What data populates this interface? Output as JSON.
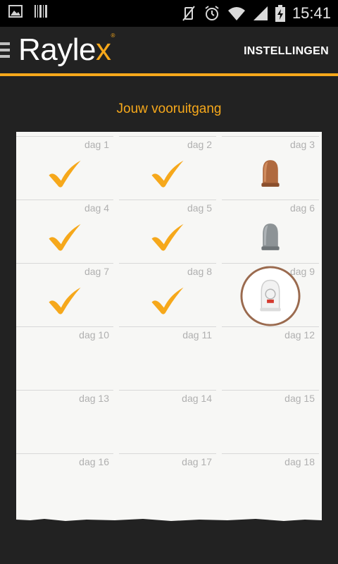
{
  "status": {
    "time": "15:41"
  },
  "header": {
    "logo_main": "Rayle",
    "logo_x": "x",
    "settings_label": "INSTELLINGEN"
  },
  "progress": {
    "title": "Jouw vooruitgang",
    "days": [
      {
        "label": "dag 1",
        "state": "check"
      },
      {
        "label": "dag 2",
        "state": "check"
      },
      {
        "label": "dag 3",
        "state": "thimble-wood"
      },
      {
        "label": "dag 4",
        "state": "check"
      },
      {
        "label": "dag 5",
        "state": "check"
      },
      {
        "label": "dag 6",
        "state": "thimble-silver"
      },
      {
        "label": "dag 7",
        "state": "check"
      },
      {
        "label": "dag 8",
        "state": "check"
      },
      {
        "label": "dag 9",
        "state": "thimble-white-current"
      },
      {
        "label": "dag 10",
        "state": "empty"
      },
      {
        "label": "dag 11",
        "state": "empty"
      },
      {
        "label": "dag 12",
        "state": "empty"
      },
      {
        "label": "dag 13",
        "state": "empty"
      },
      {
        "label": "dag 14",
        "state": "empty"
      },
      {
        "label": "dag 15",
        "state": "empty"
      },
      {
        "label": "dag 16",
        "state": "empty"
      },
      {
        "label": "dag 17",
        "state": "empty"
      },
      {
        "label": "dag 18",
        "state": "empty"
      }
    ]
  },
  "colors": {
    "accent": "#f6a81b",
    "background": "#222222",
    "panel": "#f7f7f5"
  }
}
